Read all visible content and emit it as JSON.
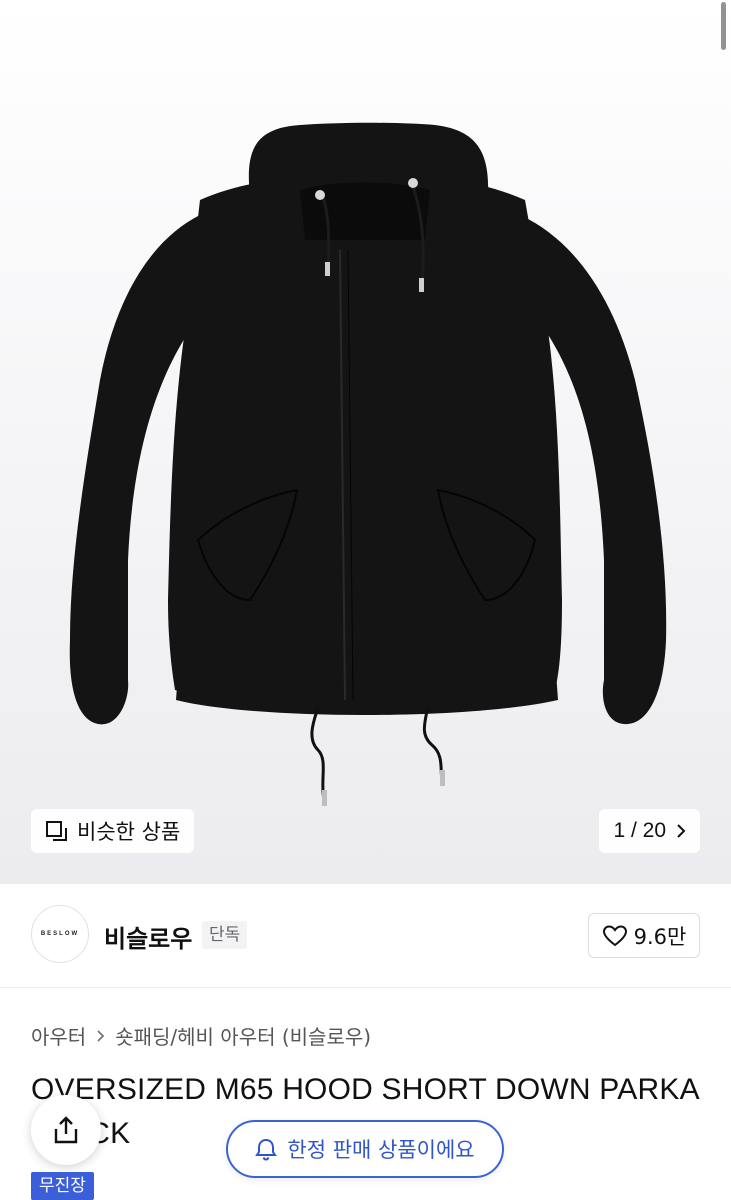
{
  "gallery": {
    "similar_label": "비슷한 상품",
    "counter": "1 / 20"
  },
  "brand": {
    "logo_text": "BESLOW",
    "name": "비슬로우",
    "badge": "단독",
    "likes": "9.6만"
  },
  "category": {
    "level1": "아우터",
    "level2": "숏패딩/헤비 아우터 (비슬로우)"
  },
  "product": {
    "title": "OVERSIZED M65 HOOD SHORT DOWN PARKA BLACK"
  },
  "floating": {
    "limited_label": "한정 판매 상품이에요"
  },
  "tags": {
    "shipping": "무진장"
  },
  "colors": {
    "accent": "#3a63d6",
    "tag_bg": "#3b5fd9",
    "jacket": "#141414"
  },
  "icons": [
    "similar-icon",
    "chevron-right-icon",
    "heart-icon",
    "share-icon",
    "bell-icon"
  ]
}
